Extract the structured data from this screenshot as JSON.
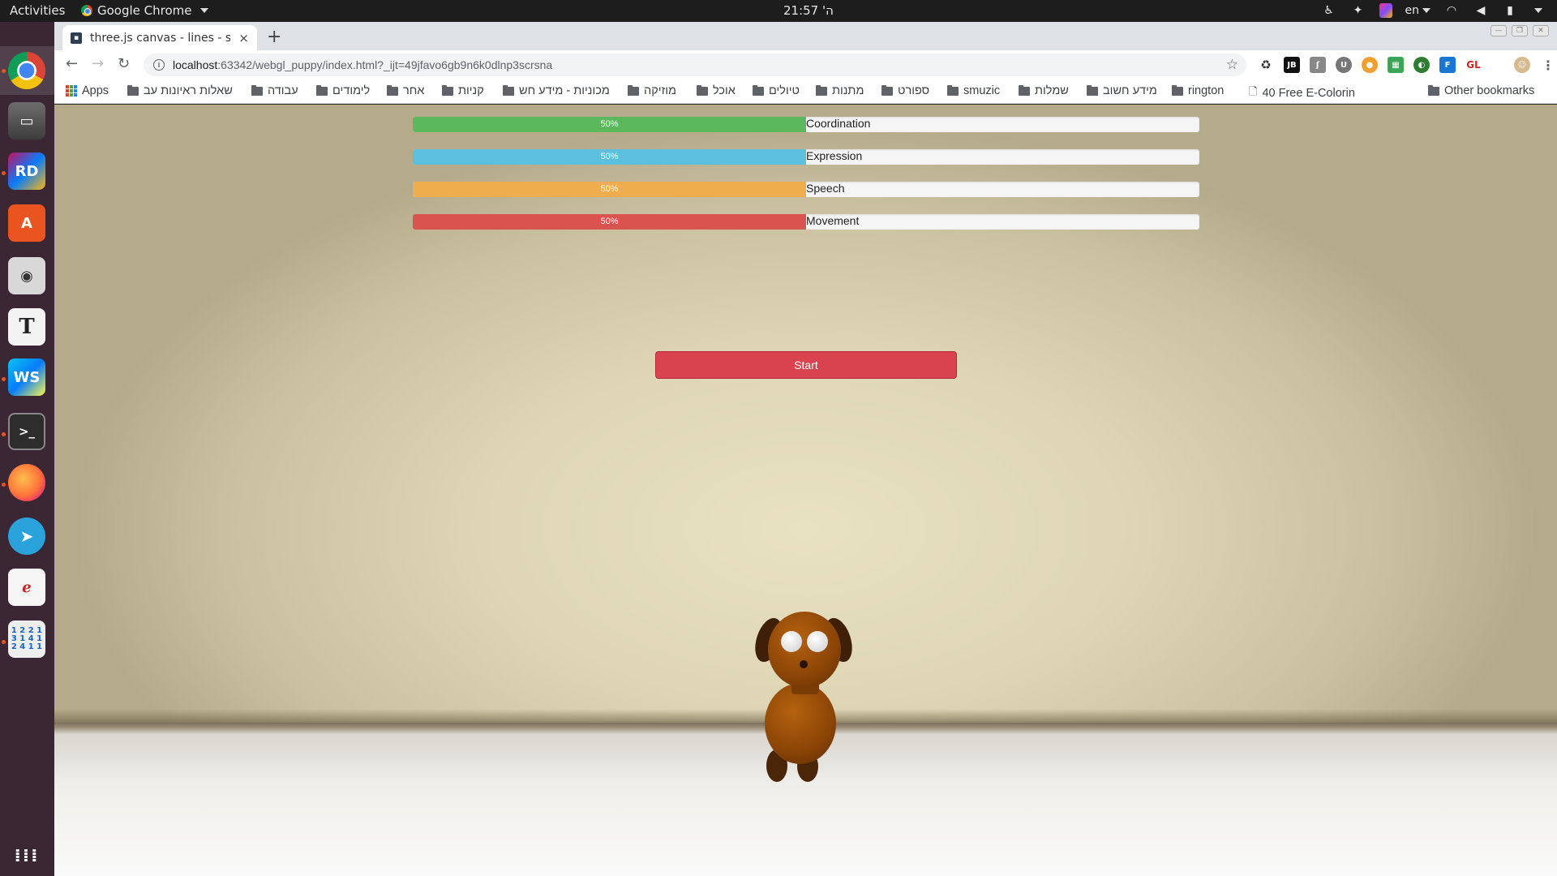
{
  "topbar": {
    "activities": "Activities",
    "app_name": "Google Chrome",
    "clock": "21:57 'ה",
    "language": "en"
  },
  "tab": {
    "title": "three.js canvas - lines - sp",
    "close": "×",
    "new_tab": "+"
  },
  "toolbar": {
    "url_host": "localhost",
    "url_path": ":63342/webgl_puppy/index.html?_ijt=49jfavo6gb9n6k0dlnp3scrsna"
  },
  "bookmarks": {
    "apps": "Apps",
    "items": [
      "שאלות ראיונות עב",
      "עבודה",
      "לימודים",
      "אחר",
      "קניות",
      "מכוניות - מידע חש",
      "מוזיקה",
      "אוכל",
      "טיולים",
      "מתנות",
      "ספורט",
      "smuzic",
      "שמלות",
      "מידע חשוב",
      "rington"
    ],
    "page_item": "40 Free E-Colorin",
    "other": "Other bookmarks"
  },
  "skills": [
    {
      "label": "Coordination",
      "value_text": "50%",
      "value": 0.5,
      "color": "#5cb85c"
    },
    {
      "label": "Expression",
      "value_text": "50%",
      "value": 0.5,
      "color": "#5bc0de"
    },
    {
      "label": "Speech",
      "value_text": "50%",
      "value": 0.5,
      "color": "#f0ad4e"
    },
    {
      "label": "Movement",
      "value_text": "50%",
      "value": 0.5,
      "color": "#d9534f"
    }
  ],
  "start_button": {
    "label": "Start",
    "color": "#d9434f"
  },
  "dock": {
    "apps": [
      "chrome-icon",
      "files-icon",
      "rider-icon",
      "software-center-icon",
      "screenshot-icon",
      "typora-icon",
      "webstorm-icon",
      "terminal-icon",
      "firefox-icon",
      "telegram-icon",
      "document-viewer-icon",
      "sudoku-icon",
      "show-apps-icon"
    ]
  }
}
